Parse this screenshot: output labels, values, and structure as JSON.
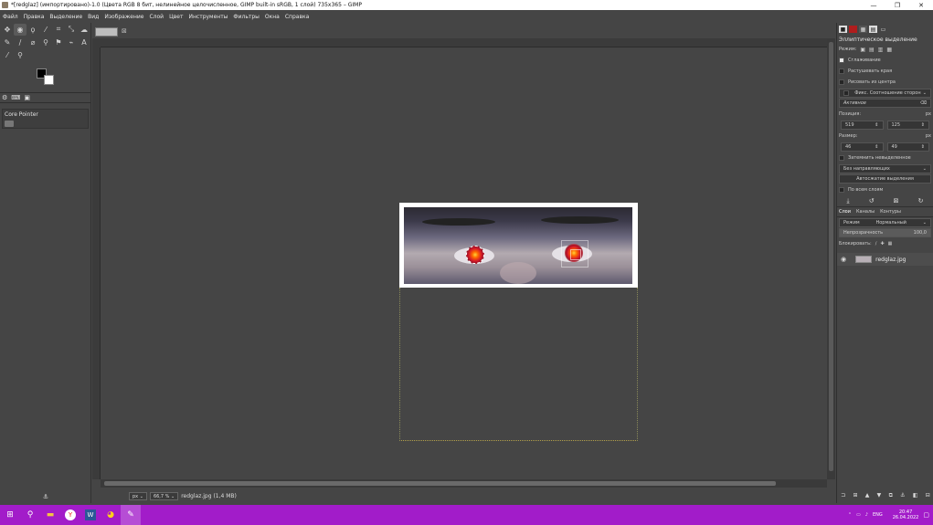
{
  "window": {
    "title": "*[redglaz] (импортировано)-1.0 (Цвета RGB 8 бит, нелинейное целочисленное, GIMP built-in sRGB, 1 слой) 735x365 – GIMP",
    "minimize": "—",
    "maximize": "❐",
    "close": "✕"
  },
  "menu": [
    "Файл",
    "Правка",
    "Выделение",
    "Вид",
    "Изображение",
    "Слой",
    "Цвет",
    "Инструменты",
    "Фильтры",
    "Окна",
    "Справка"
  ],
  "toolbox": {
    "rows": [
      [
        {
          "name": "move-tool-icon",
          "g": "✥"
        },
        {
          "name": "ellipse-select-tool-icon",
          "g": "◉",
          "active": true
        },
        {
          "name": "free-select-tool-icon",
          "g": "ϙ"
        },
        {
          "name": "fuzzy-select-tool-icon",
          "g": "⁄"
        },
        {
          "name": "crop-tool-icon",
          "g": "⌗"
        },
        {
          "name": "unified-transform-tool-icon",
          "g": "⤡"
        },
        {
          "name": "warp-transform-tool-icon",
          "g": "☁"
        }
      ],
      [
        {
          "name": "paintbrush-tool-icon",
          "g": "✎"
        },
        {
          "name": "smudge-tool-icon",
          "g": "∕"
        },
        {
          "name": "eraser-tool-icon",
          "g": "⌀"
        },
        {
          "name": "clone-tool-icon",
          "g": "⚲"
        },
        {
          "name": "dodge-tool-icon",
          "g": "⚑"
        },
        {
          "name": "path-tool-icon",
          "g": "⌁"
        },
        {
          "name": "text-tool-icon",
          "g": "A"
        }
      ],
      [
        {
          "name": "color-picker-tool-icon",
          "g": "⁄"
        },
        {
          "name": "zoom-tool-icon",
          "g": "⚲"
        }
      ]
    ],
    "dock_tab_icons": [
      "tool-options-icon",
      "device-status-icon",
      "undo-history-icon"
    ],
    "core_pointer": "Core Pointer"
  },
  "status": {
    "unit": "px",
    "zoom": "66,7 %",
    "text": "redglaz.jpg (1,4 MB)"
  },
  "right_dock": {
    "tool_title": "Эллиптическое выделение",
    "mode_label": "Режим:",
    "antialias": "Сглаживание",
    "feather": "Растушевать края",
    "from_center": "Рисовать из центра",
    "fixed": "Фикс. Соотношение сторон",
    "active": "Активное",
    "position_label": "Позиция:",
    "position_unit": "px",
    "pos_x": "519",
    "pos_y": "125",
    "size_label": "Размер:",
    "size_unit": "px",
    "size_w": "46",
    "size_h": "49",
    "highlight": "Затемнить невыделенное",
    "guides": "Без направляющих",
    "autoshrink": "Автосжатие выделения",
    "all_layers": "По всем слоям",
    "tabs": [
      "Слои",
      "Каналы",
      "Контуры"
    ],
    "layer_mode_label": "Режим",
    "layer_mode": "Нормальный",
    "opacity_label": "Непрозрачность",
    "opacity_value": "100,0",
    "lock_label": "Блокировать:",
    "layer_name": "redglaz.jpg"
  },
  "taskbar": {
    "lang": "ENG",
    "time": "20:47",
    "date": "26.04.2022"
  }
}
